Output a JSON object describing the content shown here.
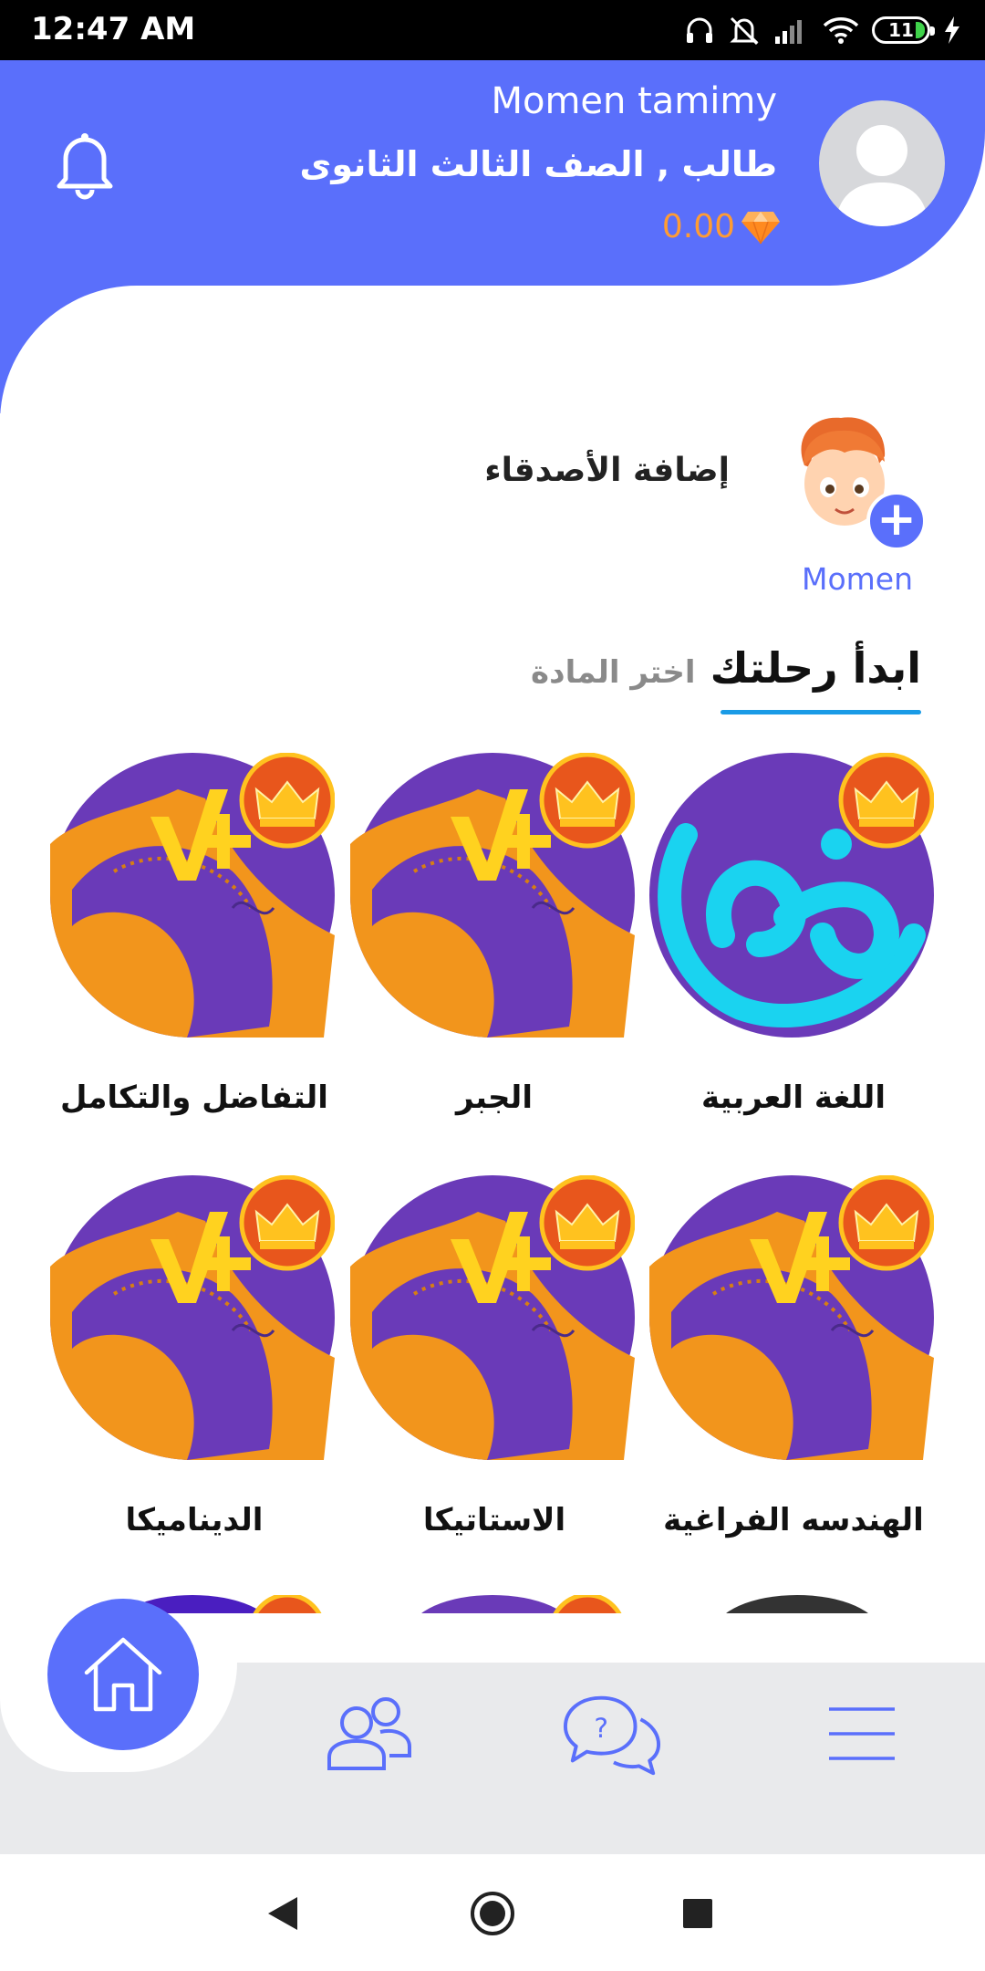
{
  "status_bar": {
    "time": "12:47 AM",
    "battery": "11",
    "icons": [
      "headphones-icon",
      "mute-icon",
      "signal-icon",
      "wifi-icon",
      "battery-icon",
      "charging-icon"
    ]
  },
  "header": {
    "user_name": "Momen tamimy",
    "user_grade": "طالب , الصف الثالث الثانوى",
    "points": "0.00",
    "icons": [
      "bell-icon",
      "avatar",
      "diamond-icon"
    ],
    "colors": {
      "primary": "#5a6ffb",
      "points": "#ff9c33"
    }
  },
  "friends": {
    "add_label": "إضافة الأصدقاء",
    "friend_name": "Momen"
  },
  "section": {
    "title": "ابدأ رحلتك",
    "subtitle": "اختر المادة",
    "underline_color": "#1a9be6"
  },
  "subjects": [
    {
      "label": "اللغة العربية",
      "icon": "arabic-letter-icon",
      "premium": true
    },
    {
      "label": "الجبر",
      "icon": "math-icon",
      "premium": true
    },
    {
      "label": "التفاضل والتكامل",
      "icon": "math-icon",
      "premium": true
    },
    {
      "label": "الهندسه الفراغية",
      "icon": "math-icon",
      "premium": true
    },
    {
      "label": "الاستاتيكا",
      "icon": "math-icon",
      "premium": true
    },
    {
      "label": "الديناميكا",
      "icon": "math-icon",
      "premium": true
    }
  ],
  "bottom_nav": {
    "items": [
      "home-icon",
      "friends-icon",
      "questions-icon",
      "menu-icon"
    ]
  },
  "system_nav": [
    "back-icon",
    "home-circle-icon",
    "recents-icon"
  ]
}
